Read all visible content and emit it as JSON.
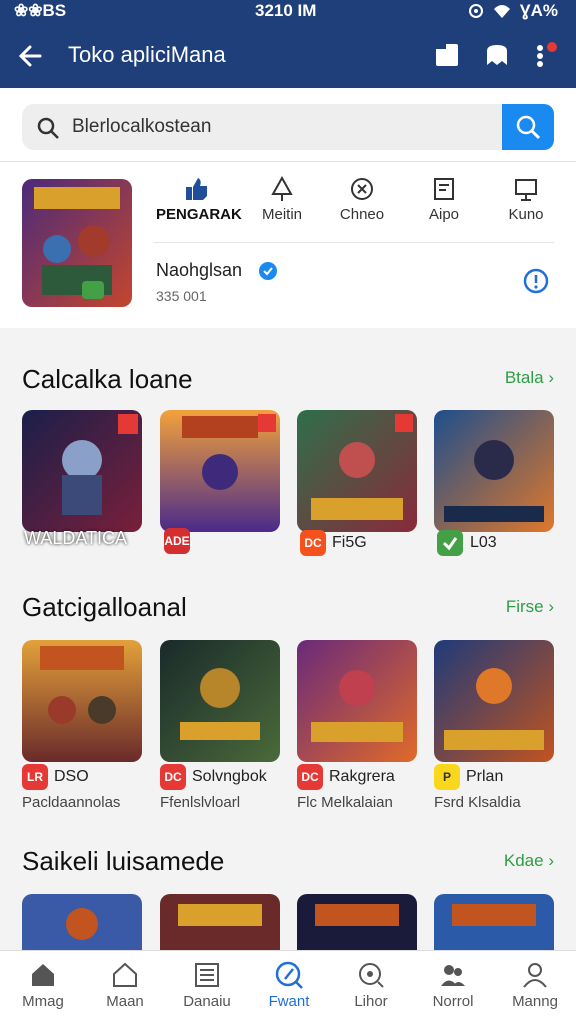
{
  "status": {
    "left": "❀❀BS",
    "time": "3210 IM",
    "battery": "ƔA%"
  },
  "appbar": {
    "title": "Toko apliciMana"
  },
  "search": {
    "placeholder": "Blerlocalkostean"
  },
  "featured": {
    "categories": [
      {
        "label": "PENGARAK",
        "icon": "thumb-icon"
      },
      {
        "label": "Meitin",
        "icon": "tree-icon"
      },
      {
        "label": "Chneo",
        "icon": "gamepad-icon"
      },
      {
        "label": "Aipo",
        "icon": "doc-icon"
      },
      {
        "label": "Kuno",
        "icon": "cast-icon"
      }
    ],
    "app_name": "Naohglsan",
    "app_size": "335 001"
  },
  "sections": [
    {
      "title": "Calcalka loane",
      "more": "Btala",
      "items": [
        {
          "label": "WALDATICA",
          "sub": "",
          "badge": "",
          "badge_color": "#e53935"
        },
        {
          "label": "",
          "sub": "",
          "badge": "ADE",
          "badge_color": "#d32f2f"
        },
        {
          "label": "Fi5G",
          "sub": "",
          "badge": "DC",
          "badge_color": "#f4511e"
        },
        {
          "label": "L03",
          "sub": "",
          "badge": "",
          "badge_color": "#43a047"
        }
      ]
    },
    {
      "title": "Gatcigalloanal",
      "more": "Firse",
      "items": [
        {
          "label": "DSO",
          "sub": "Pacldaannolas",
          "badge": "LR",
          "badge_color": "#e53935"
        },
        {
          "label": "Solvngbok",
          "sub": "Ffenlslvloarl",
          "badge": "DC",
          "badge_color": "#e53935"
        },
        {
          "label": "Rakgrera",
          "sub": "Flc Melkalaian",
          "badge": "DC",
          "badge_color": "#e53935"
        },
        {
          "label": "Prlan",
          "sub": "Fsrd Klsaldia",
          "badge": "P",
          "badge_color": "#f9d71c"
        }
      ]
    },
    {
      "title": "Saikeli luisamede",
      "more": "Kdae"
    }
  ],
  "nav": [
    {
      "label": "Mmag",
      "icon": "home-icon"
    },
    {
      "label": "Maan",
      "icon": "house-outline-icon"
    },
    {
      "label": "Danaiu",
      "icon": "newspaper-icon"
    },
    {
      "label": "Fwant",
      "icon": "search-circle-icon",
      "active": true
    },
    {
      "label": "Lihor",
      "icon": "settings-icon"
    },
    {
      "label": "Norrol",
      "icon": "person-group-icon"
    },
    {
      "label": "Manng",
      "icon": "person-icon"
    }
  ],
  "colors": {
    "header": "#1f3f7a",
    "accent": "#1a8af0",
    "more_link": "#2e9e44"
  }
}
